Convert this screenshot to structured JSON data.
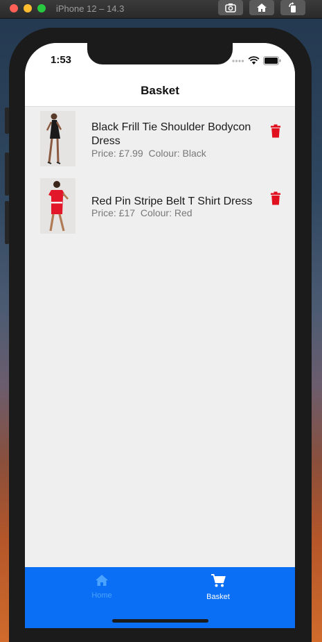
{
  "window": {
    "title": "iPhone 12 – 14.3",
    "toolbar": [
      "screenshot-icon",
      "home-icon",
      "rotate-icon"
    ]
  },
  "status_bar": {
    "time": "1:53"
  },
  "header": {
    "title": "Basket"
  },
  "basket": {
    "items": [
      {
        "name": "Black Frill Tie Shoulder Bodycon Dress",
        "price": "Price: £7.99",
        "colour": "Colour: Black",
        "image_color": "#1a1a1a",
        "action_icon": "trash-icon"
      },
      {
        "name": "Red Pin Stripe Belt T Shirt Dress",
        "price": "Price: £17",
        "colour": "Colour: Red",
        "image_color": "#e2182a",
        "action_icon": "trash-icon"
      }
    ]
  },
  "tabs": [
    {
      "label": "Home",
      "icon": "home-icon",
      "active": false
    },
    {
      "label": "Basket",
      "icon": "cart-icon",
      "active": true
    }
  ],
  "colors": {
    "accent": "#0a6ff5",
    "delete": "#e0101e",
    "tab_inactive": "#4aa3ff",
    "tab_active": "#ffffff"
  }
}
